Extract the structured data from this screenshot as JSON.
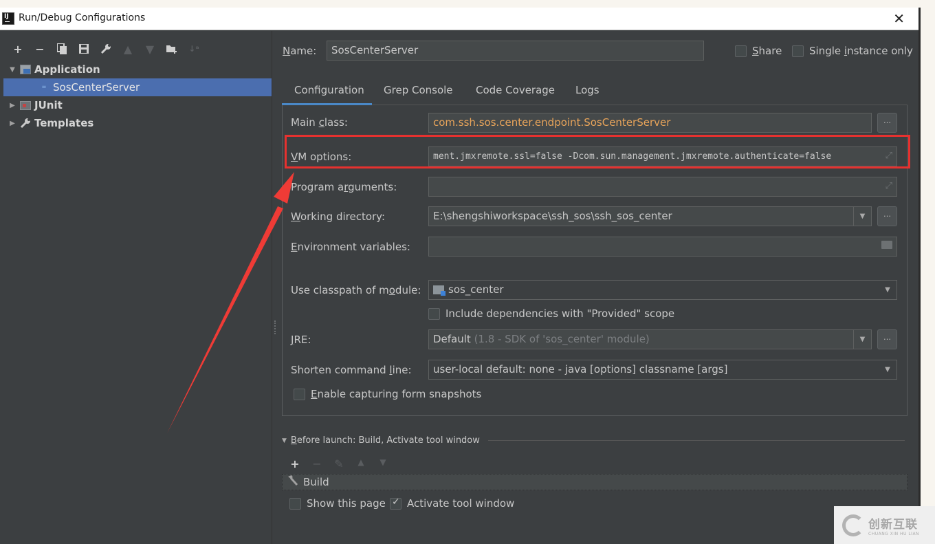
{
  "window": {
    "title": "Run/Debug Configurations",
    "app_icon": "intellij-idea-icon",
    "close_label": "✕"
  },
  "toolbar": {
    "items": [
      {
        "name": "add-icon",
        "glyph": "+",
        "enabled": true
      },
      {
        "name": "remove-icon",
        "glyph": "−",
        "enabled": true
      },
      {
        "name": "copy-icon",
        "glyph": "⧉",
        "enabled": true
      },
      {
        "name": "save-icon",
        "glyph": "🖫",
        "enabled": true
      },
      {
        "name": "wrench-icon",
        "glyph": "🔧",
        "enabled": true
      },
      {
        "name": "move-up-icon",
        "glyph": "▲",
        "enabled": false
      },
      {
        "name": "move-down-icon",
        "glyph": "▼",
        "enabled": false
      },
      {
        "name": "new-folder-icon",
        "glyph": "📁",
        "enabled": true
      },
      {
        "name": "sort-icon",
        "glyph": "↓ᵃ",
        "enabled": false
      }
    ]
  },
  "tree": {
    "application": "Application",
    "selected": "SosCenterServer",
    "junit": "JUnit",
    "templates": "Templates",
    "expanded_arrow": "▼",
    "collapsed_arrow": "▶"
  },
  "header": {
    "name_label_u": "N",
    "name_label_rest": "ame:",
    "name_value": "SosCenterServer",
    "share_u": "S",
    "share_rest": "hare",
    "share_checked": false,
    "single_pre": "Single ",
    "single_u": "i",
    "single_rest": "nstance only",
    "single_checked": false
  },
  "tabs": [
    {
      "label": "Configuration",
      "active": true
    },
    {
      "label": "Grep Console",
      "active": false
    },
    {
      "label": "Code Coverage",
      "active": false
    },
    {
      "label": "Logs",
      "active": false
    }
  ],
  "form": {
    "main_class": {
      "label_pre": "Main ",
      "label_u": "c",
      "label_rest": "lass:",
      "value": "com.ssh.sos.center.endpoint.SosCenterServer"
    },
    "vm_options": {
      "label_u": "V",
      "label_rest": "M options:",
      "value": "ment.jmxremote.ssl=false -Dcom.sun.management.jmxremote.authenticate=false"
    },
    "program_args": {
      "label_pre": "Program a",
      "label_u": "r",
      "label_rest": "guments:",
      "value": ""
    },
    "working_dir": {
      "label_u": "W",
      "label_rest": "orking directory:",
      "value": "E:\\shengshiworkspace\\ssh_sos\\ssh_sos_center"
    },
    "env_vars": {
      "label_u": "E",
      "label_rest": "nvironment variables:",
      "value": ""
    },
    "classpath_module": {
      "label_pre": "Use classpath of m",
      "label_u": "o",
      "label_rest": "dule:",
      "value": "sos_center"
    },
    "include_provided": {
      "label": "Include dependencies with \"Provided\" scope",
      "checked": false
    },
    "jre": {
      "label_u": "J",
      "label_rest": "RE:",
      "value_main": "Default",
      "value_hint": " (1.8 - SDK of 'sos_center' module)"
    },
    "shorten_cmd": {
      "label_pre": "Shorten command ",
      "label_u": "l",
      "label_rest": "ine:",
      "value": "user-local default: none - java [options] classname [args]"
    },
    "capture_snapshots": {
      "label_u": "E",
      "label_rest": "nable capturing form snapshots",
      "checked": false
    }
  },
  "before_launch": {
    "title_u": "B",
    "title_rest": "efore launch: Build, Activate tool window",
    "tools": [
      {
        "name": "add-icon",
        "glyph": "+",
        "enabled": true
      },
      {
        "name": "remove-icon",
        "glyph": "−",
        "enabled": false
      },
      {
        "name": "edit-icon",
        "glyph": "✎",
        "enabled": false
      },
      {
        "name": "move-up-icon",
        "glyph": "▲",
        "enabled": false
      },
      {
        "name": "move-down-icon",
        "glyph": "▼",
        "enabled": false
      }
    ],
    "task": "Build",
    "show_page": {
      "label": "Show this page",
      "checked": false
    },
    "activate_tool": {
      "label": "Activate tool window",
      "checked": true
    }
  },
  "annotation": {
    "color": "#e6312f"
  },
  "watermark": {
    "cn": "创新互联",
    "py": "CHUANG XIN HU LIAN"
  }
}
